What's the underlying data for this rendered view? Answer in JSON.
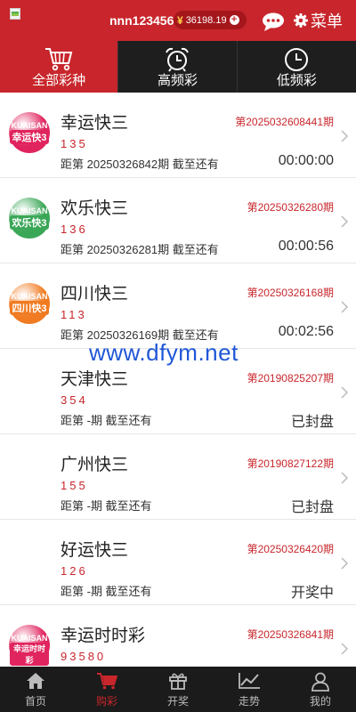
{
  "header": {
    "username": "nnn123456",
    "currency_symbol": "¥",
    "balance": "36198.19",
    "menu_label": "菜单"
  },
  "category_tabs": [
    {
      "label": "全部彩种",
      "icon": "cart-icon",
      "active": true
    },
    {
      "label": "高频彩",
      "icon": "alarm-clock-icon",
      "active": false
    },
    {
      "label": "低频彩",
      "icon": "clock-icon",
      "active": false
    }
  ],
  "lotteries": [
    {
      "name": "幸运快三",
      "issue": "第2025032608441期",
      "numbers": "135",
      "deadline": "距第 20250326842期 截至还有",
      "status": "00:00:00",
      "logo_text": "幸运快3",
      "logo_color": "#e0245e"
    },
    {
      "name": "欢乐快三",
      "issue": "第20250326280期",
      "numbers": "136",
      "deadline": "距第 20250326281期 截至还有",
      "status": "00:00:56",
      "logo_text": "欢乐快3",
      "logo_color": "#3aa757"
    },
    {
      "name": "四川快三",
      "issue": "第20250326168期",
      "numbers": "113",
      "deadline": "距第 20250326169期 截至还有",
      "status": "00:02:56",
      "logo_text": "四川快3",
      "logo_color": "#f07b22"
    },
    {
      "name": "天津快三",
      "issue": "第20190825207期",
      "numbers": "354",
      "deadline": "距第 -期 截至还有",
      "status": "已封盘",
      "logo_text": "",
      "logo_color": ""
    },
    {
      "name": "广州快三",
      "issue": "第20190827122期",
      "numbers": "155",
      "deadline": "距第 -期 截至还有",
      "status": "已封盘",
      "logo_text": "",
      "logo_color": ""
    },
    {
      "name": "好运快三",
      "issue": "第20250326420期",
      "numbers": "126",
      "deadline": "距第 -期 截至还有",
      "status": "开奖中",
      "logo_text": "",
      "logo_color": ""
    },
    {
      "name": "幸运时时彩",
      "issue": "第20250326841期",
      "numbers": "93580",
      "deadline": "",
      "status": "",
      "logo_text": "幸运时时彩",
      "logo_color": "#e0245e"
    }
  ],
  "watermark": "www.dfym.net",
  "bottom_nav": [
    {
      "label": "首页",
      "icon": "home-icon",
      "active": false
    },
    {
      "label": "购彩",
      "icon": "cart-icon",
      "active": true
    },
    {
      "label": "开奖",
      "icon": "gift-icon",
      "active": false
    },
    {
      "label": "走势",
      "icon": "trend-chart-icon",
      "active": false
    },
    {
      "label": "我的",
      "icon": "user-icon",
      "active": false
    }
  ],
  "colors": {
    "brand": "#c8262c",
    "dark": "#1e1e1e",
    "watermark": "#1f57d6"
  }
}
